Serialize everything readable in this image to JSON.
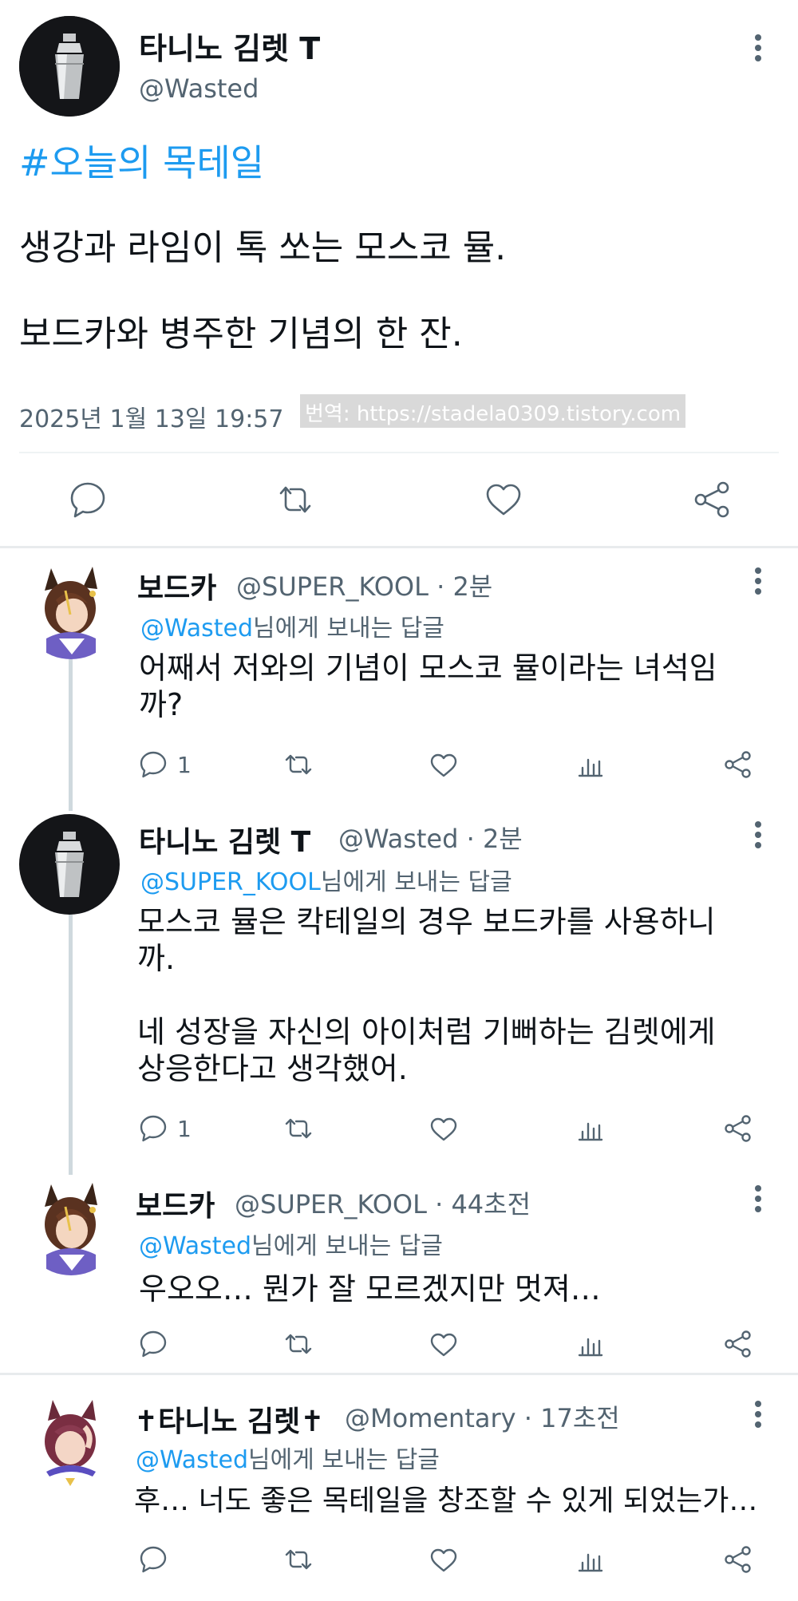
{
  "main_tweet": {
    "author_name": "타니노 김렛 T",
    "author_handle": "@Wasted",
    "hashtag": "#오늘의 목테일",
    "text_line1": "생강과 라임이 톡 쏘는 모스코 뮬.",
    "text_line2": "보드카와 병주한 기념의 한 잔.",
    "timestamp": "2025년 1월 13일  19:57",
    "watermark": "번역: https://stadela0309.tistory.com",
    "avatar_icon": "cocktail-shaker-icon"
  },
  "main_actions": [
    "reply-icon",
    "retweet-icon",
    "like-icon",
    "share-icon"
  ],
  "replies": [
    {
      "name": "보드카",
      "meta": "@SUPER_KOOL · 2분",
      "reply_mention": "@Wasted",
      "reply_suffix": "님에게 보내는 답글",
      "text_lines": [
        "어째서 저와의 기념이 모스코 뮬이라는 녀석임",
        "까?"
      ],
      "reply_count": "1",
      "avatar_icon": "horse-girl-avatar-icon"
    },
    {
      "name": "타니노 김렛 T",
      "meta": "@Wasted · 2분",
      "reply_mention": "@SUPER_KOOL",
      "reply_suffix": "님에게 보내는 답글",
      "text_lines": [
        "모스코 뮬은 칵테일의 경우 보드카를 사용하니",
        "까.",
        "",
        "네 성장을 자신의 아이처럼 기뻐하는 김렛에게",
        "상응한다고 생각했어."
      ],
      "reply_count": "1",
      "avatar_icon": "cocktail-shaker-icon"
    },
    {
      "name": "보드카",
      "meta": "@SUPER_KOOL · 44초전",
      "reply_mention": "@Wasted",
      "reply_suffix": "님에게 보내는 답글",
      "text_lines": [
        "우오오… 뭔가 잘 모르겠지만 멋져…"
      ],
      "reply_count": "",
      "avatar_icon": "horse-girl-avatar-icon"
    },
    {
      "name": "✝타니노 김렛✝",
      "meta": "@Momentary · 17초전",
      "reply_mention": "@Wasted",
      "reply_suffix": "님에게 보내는 답글",
      "text_lines": [
        "후… 너도 좋은 목테일을 창조할 수 있게 되었는가…"
      ],
      "reply_count": "",
      "avatar_icon": "horse-girl-avatar-icon"
    }
  ],
  "colors": {
    "link": "#1d9bf0",
    "secondary_text": "#536471",
    "primary_text": "#0f1419",
    "divider": "#eff3f4"
  }
}
